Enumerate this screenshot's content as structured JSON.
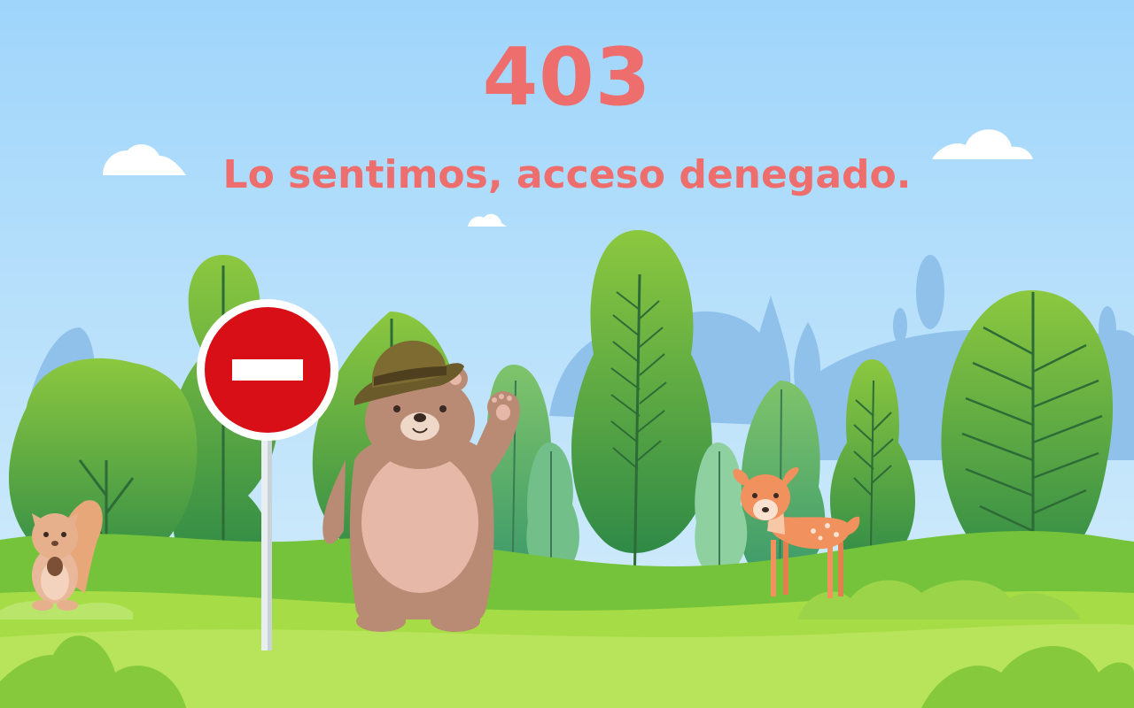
{
  "error": {
    "code": "403",
    "message": "Lo sentimos, acceso denegado."
  },
  "colors": {
    "text": "#ee6e6e",
    "sky_top": "#9fd5fb",
    "sky_bottom": "#d2ecfa",
    "grass": "#a6dc45",
    "sign_red": "#d80f16"
  },
  "illustration": {
    "characters": [
      "bear-with-hat",
      "squirrel",
      "fawn"
    ],
    "props": [
      "no-entry-sign",
      "trees",
      "clouds",
      "hills",
      "bushes"
    ]
  }
}
